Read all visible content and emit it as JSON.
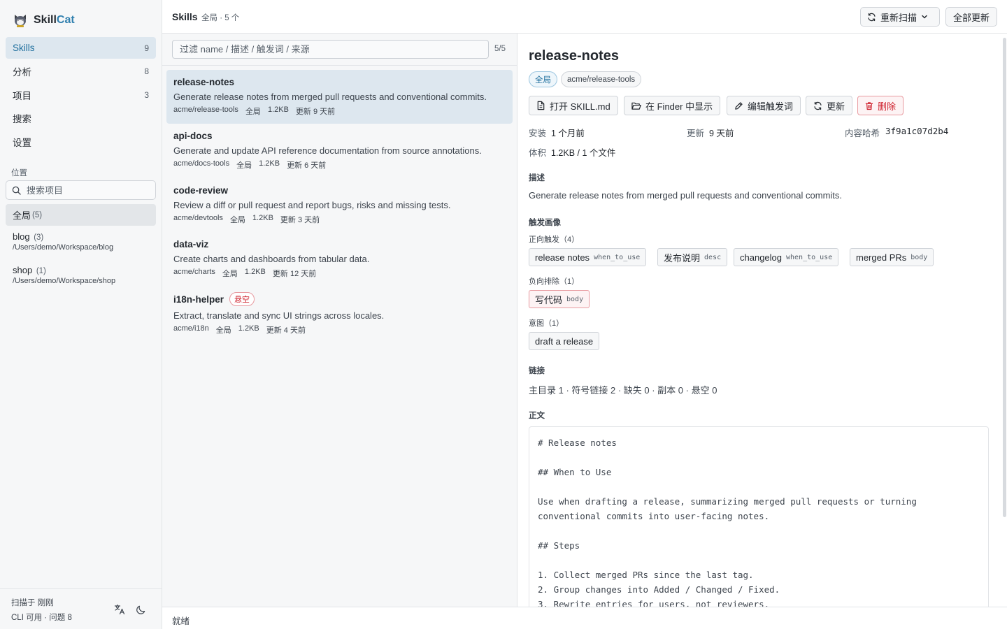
{
  "app": {
    "brand_a": "Skill",
    "brand_b": "Cat"
  },
  "nav": [
    {
      "label": "Skills",
      "count": "9"
    },
    {
      "label": "分析",
      "count": "8"
    },
    {
      "label": "项目",
      "count": "3"
    },
    {
      "label": "搜索",
      "count": ""
    },
    {
      "label": "设置",
      "count": ""
    }
  ],
  "locations": {
    "label": "位置",
    "search_placeholder": "搜索项目",
    "items": [
      {
        "name": "全局",
        "count": "(5)",
        "path": ""
      },
      {
        "name": "blog",
        "count": "(3)",
        "path": "/Users/demo/Workspace/blog"
      },
      {
        "name": "shop",
        "count": "(1)",
        "path": "/Users/demo/Workspace/shop"
      }
    ]
  },
  "footer": {
    "scan": "扫描于 刚刚",
    "status": "CLI 可用 · 问题 8",
    "lang_icon": "translate-icon",
    "theme_icon": "moon-icon"
  },
  "topbar": {
    "title": "Skills",
    "subtitle": "全局 · 5 个",
    "rescan_label": "重新扫描",
    "update_all_label": "全部更新"
  },
  "list": {
    "filter_placeholder": "过滤 name / 描述 / 触发词 / 来源",
    "filter_count": "5/5",
    "orphan_label": "悬空",
    "items": [
      {
        "name": "release-notes",
        "desc": "Generate release notes from merged pull requests and conventional commits.",
        "source": "acme/release-tools",
        "scope": "全局",
        "size": "1.2KB",
        "updated": "更新 9 天前"
      },
      {
        "name": "api-docs",
        "desc": "Generate and update API reference documentation from source annotations.",
        "source": "acme/docs-tools",
        "scope": "全局",
        "size": "1.2KB",
        "updated": "更新 6 天前"
      },
      {
        "name": "code-review",
        "desc": "Review a diff or pull request and report bugs, risks and missing tests.",
        "source": "acme/devtools",
        "scope": "全局",
        "size": "1.2KB",
        "updated": "更新 3 天前"
      },
      {
        "name": "data-viz",
        "desc": "Create charts and dashboards from tabular data.",
        "source": "acme/charts",
        "scope": "全局",
        "size": "1.2KB",
        "updated": "更新 12 天前"
      },
      {
        "name": "i18n-helper",
        "desc": "Extract, translate and sync UI strings across locales.",
        "source": "acme/i18n",
        "scope": "全局",
        "size": "1.2KB",
        "updated": "更新 4 天前"
      }
    ]
  },
  "detail": {
    "title": "release-notes",
    "tags": [
      "全局",
      "acme/release-tools"
    ],
    "actions": {
      "open": "打开 SKILL.md",
      "finder": "在 Finder 中显示",
      "edit": "编辑触发词",
      "update": "更新",
      "delete": "删除"
    },
    "installed_label": "安装",
    "installed": "1 个月前",
    "updated_label": "更新",
    "updated": "9 天前",
    "hash_label": "内容哈希",
    "hash": "3f9a1c07d2b4",
    "size_label": "体积",
    "size": "1.2KB / 1 个文件",
    "desc_title": "描述",
    "desc": "Generate release notes from merged pull requests and conventional commits.",
    "triggers_title": "触发画像",
    "positive_label": "正向触发（4）",
    "positive": [
      {
        "text": "release notes",
        "tag": "when_to_use"
      },
      {
        "text": "发布说明",
        "tag": "desc"
      },
      {
        "text": "changelog",
        "tag": "when_to_use"
      },
      {
        "text": "merged PRs",
        "tag": "body"
      }
    ],
    "negative_label": "负向排除（1）",
    "negative": [
      {
        "text": "写代码",
        "tag": "body"
      }
    ],
    "intent_label": "意图（1）",
    "intent": [
      {
        "text": "draft a release"
      }
    ],
    "links_title": "链接",
    "links": "主目录 1 · 符号链接 2 · 缺失 0 · 副本 0 · 悬空 0",
    "body_title": "正文",
    "body": "# Release notes\n\n## When to Use\n\nUse when drafting a release, summarizing merged pull requests or turning\nconventional commits into user-facing notes.\n\n## Steps\n\n1. Collect merged PRs since the last tag.\n2. Group changes into Added / Changed / Fixed.\n3. Rewrite entries for users, not reviewers."
  },
  "status": {
    "text": "就绪"
  },
  "colors": {
    "accent": "#2f7fae",
    "active_bg": "#dde7ef",
    "danger": "#cf222e"
  }
}
